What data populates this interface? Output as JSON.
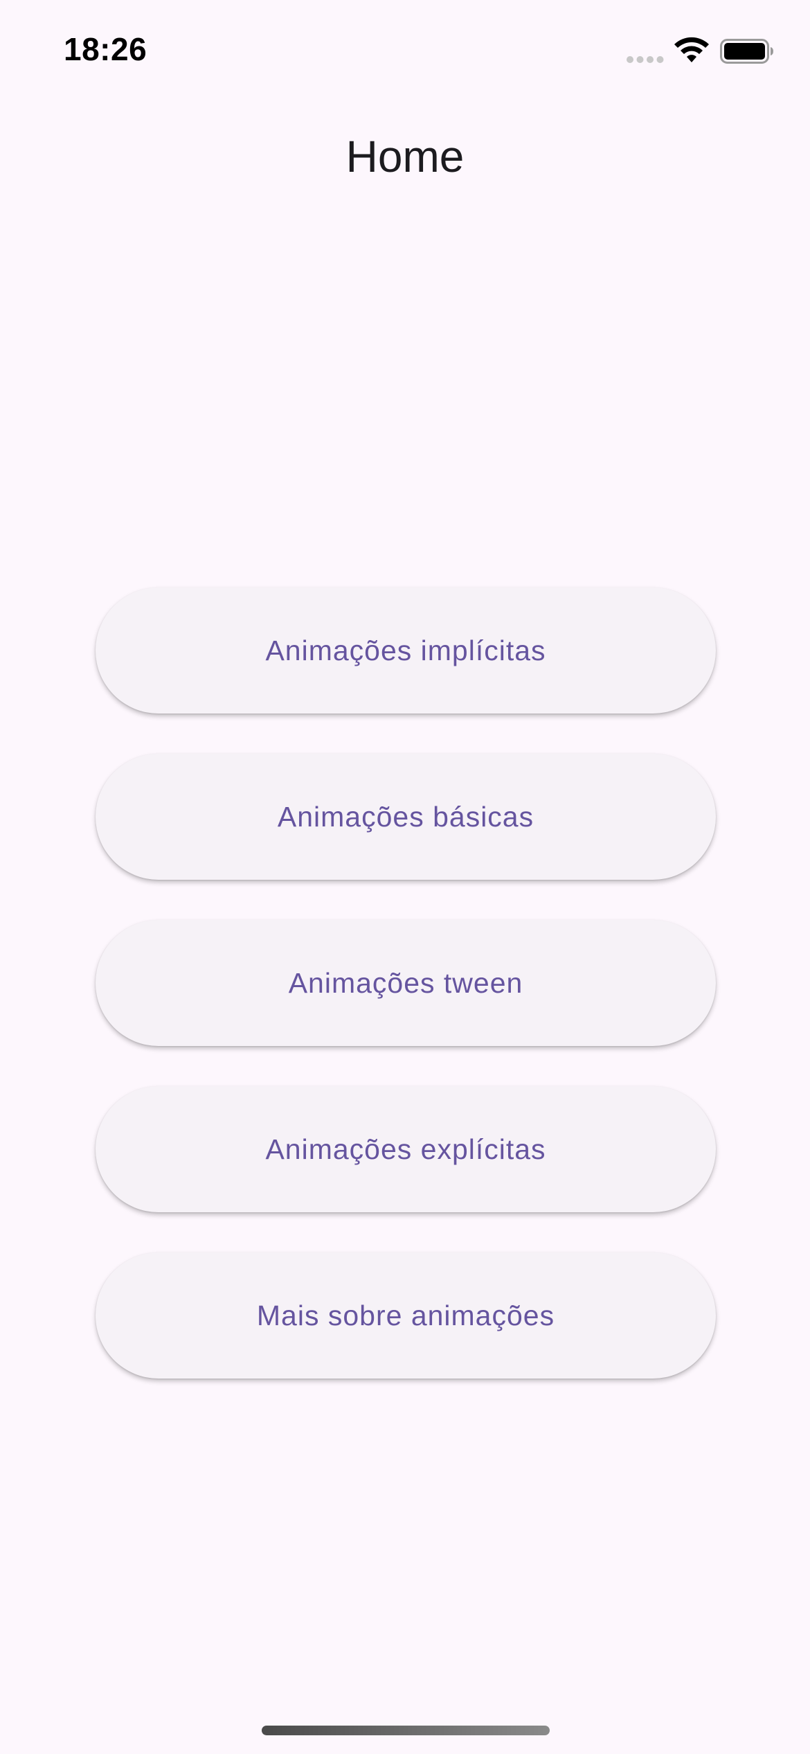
{
  "status_bar": {
    "time": "18:26",
    "icons": [
      "signal-dots-icon",
      "wifi-icon",
      "battery-icon"
    ]
  },
  "app_bar": {
    "title": "Home"
  },
  "buttons": [
    {
      "label": "Animações implícitas"
    },
    {
      "label": "Animações básicas"
    },
    {
      "label": "Animações tween"
    },
    {
      "label": "Animações explícitas"
    },
    {
      "label": "Mais sobre animações"
    }
  ],
  "colors": {
    "background": "#fdf7fd",
    "button_background": "#f6f2f7",
    "button_text": "#65549f",
    "title_text": "#1c1b1f"
  }
}
